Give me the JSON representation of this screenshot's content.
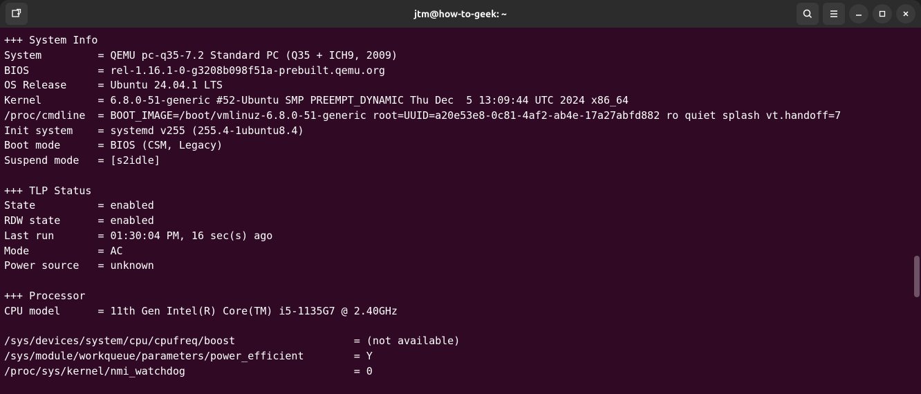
{
  "titlebar": {
    "title": "jtm@how-to-geek: ~"
  },
  "sections": {
    "system_info": {
      "header": "+++ System Info",
      "lines": [
        "System         = QEMU pc-q35-7.2 Standard PC (Q35 + ICH9, 2009)",
        "BIOS           = rel-1.16.1-0-g3208b098f51a-prebuilt.qemu.org",
        "OS Release     = Ubuntu 24.04.1 LTS",
        "Kernel         = 6.8.0-51-generic #52-Ubuntu SMP PREEMPT_DYNAMIC Thu Dec  5 13:09:44 UTC 2024 x86_64",
        "/proc/cmdline  = BOOT_IMAGE=/boot/vmlinuz-6.8.0-51-generic root=UUID=a20e53e8-0c81-4af2-ab4e-17a27abfd882 ro quiet splash vt.handoff=7",
        "Init system    = systemd v255 (255.4-1ubuntu8.4)",
        "Boot mode      = BIOS (CSM, Legacy)",
        "Suspend mode   = [s2idle]"
      ]
    },
    "tlp_status": {
      "header": "+++ TLP Status",
      "lines": [
        "State          = enabled",
        "RDW state      = enabled",
        "Last run       = 01:30:04 PM, 16 sec(s) ago",
        "Mode           = AC",
        "Power source   = unknown"
      ]
    },
    "processor": {
      "header": "+++ Processor",
      "lines": [
        "CPU model      = 11th Gen Intel(R) Core(TM) i5-1135G7 @ 2.40GHz",
        "",
        "/sys/devices/system/cpu/cpufreq/boost                   = (not available)",
        "/sys/module/workqueue/parameters/power_efficient        = Y",
        "/proc/sys/kernel/nmi_watchdog                           = 0"
      ]
    }
  }
}
